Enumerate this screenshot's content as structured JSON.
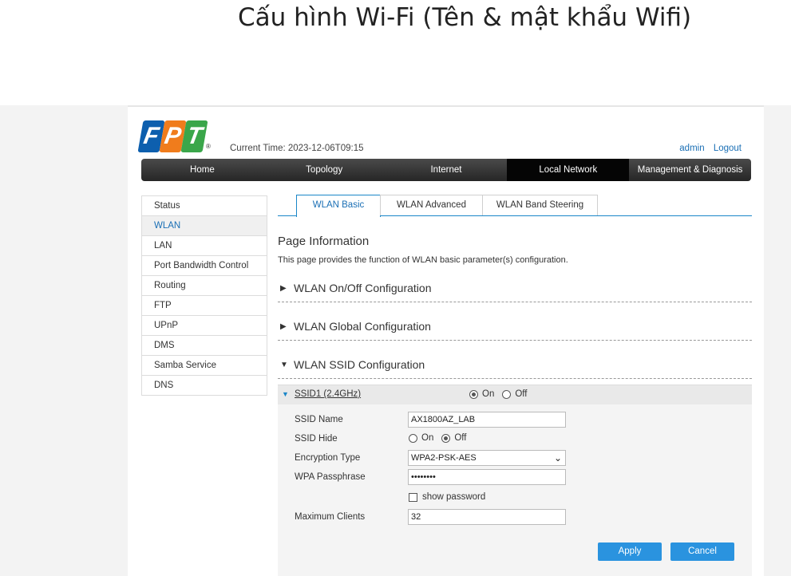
{
  "slide": {
    "title": "Cấu hình Wi-Fi (Tên & mật khẩu Wifi)"
  },
  "header": {
    "logo_letters": [
      "F",
      "P",
      "T"
    ],
    "logo_colors": [
      "#0d5fae",
      "#f07c1c",
      "#3aa64a"
    ],
    "logo_mark": "®",
    "current_time": "Current Time: 2023-12-06T09:15",
    "user": "admin",
    "logout": "Logout"
  },
  "menu": {
    "items": [
      "Home",
      "Topology",
      "Internet",
      "Local Network",
      "Management & Diagnosis"
    ],
    "active": "Local Network"
  },
  "sidebar": {
    "items": [
      "Status",
      "WLAN",
      "LAN",
      "Port Bandwidth Control",
      "Routing",
      "FTP",
      "UPnP",
      "DMS",
      "Samba Service",
      "DNS"
    ],
    "active": "WLAN"
  },
  "tabs": {
    "items": [
      "WLAN Basic",
      "WLAN Advanced",
      "WLAN Band Steering"
    ],
    "active": "WLAN Basic"
  },
  "page": {
    "title": "Page Information",
    "description": "This page provides the function of WLAN basic parameter(s) configuration."
  },
  "sections": {
    "onoff": {
      "label": "WLAN On/Off Configuration",
      "expanded": false
    },
    "global": {
      "label": "WLAN Global Configuration",
      "expanded": false
    },
    "ssid": {
      "label": "WLAN SSID Configuration",
      "expanded": true
    }
  },
  "ssid1": {
    "name": "SSID1 (2.4GHz)",
    "on_label": "On",
    "off_label": "Off",
    "state": "On",
    "fields": {
      "ssid_name_label": "SSID Name",
      "ssid_name_value": "AX1800AZ_LAB",
      "ssid_hide_label": "SSID Hide",
      "ssid_hide_on": "On",
      "ssid_hide_off": "Off",
      "ssid_hide_state": "Off",
      "encryption_label": "Encryption Type",
      "encryption_value": "WPA2-PSK-AES",
      "passphrase_label": "WPA Passphrase",
      "passphrase_value": "••••••••",
      "show_password_label": "show password",
      "show_password_checked": false,
      "max_clients_label": "Maximum Clients",
      "max_clients_value": "32"
    }
  },
  "buttons": {
    "apply": "Apply",
    "cancel": "Cancel"
  },
  "colors": {
    "accent": "#1a86c8",
    "link": "#1a6fb5",
    "button": "#2a93df"
  }
}
